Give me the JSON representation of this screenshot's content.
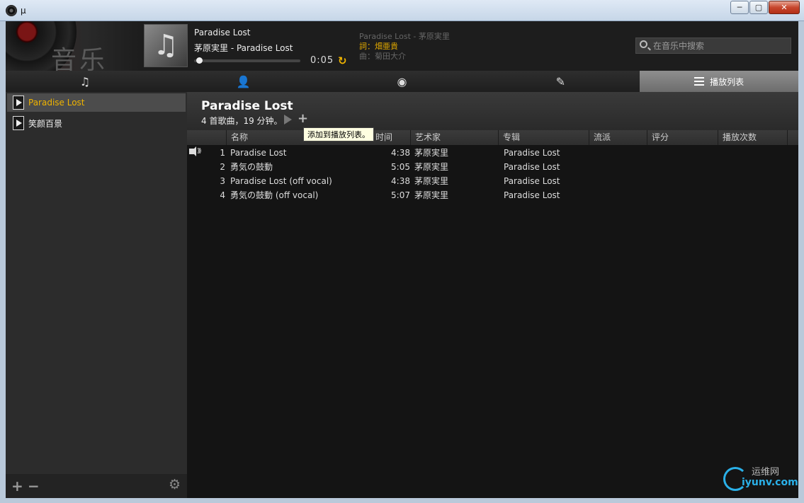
{
  "window": {
    "title": "μ",
    "minimize": "─",
    "maximize": "▢",
    "close": "✕"
  },
  "header": {
    "logo_text": "音乐",
    "now_playing": {
      "title": "Paradise Lost",
      "artist_album": "茅原実里 - Paradise Lost",
      "time": "0:05",
      "progress": 0.02
    },
    "lyrics": {
      "line1": "Paradise Lost - 茅原実里",
      "line2": "詞：畑亜貴",
      "line3": "曲：菊田大介"
    },
    "search": {
      "placeholder": "在音乐中搜索"
    }
  },
  "tabs": [
    {
      "label": "",
      "icon": "music-note-icon"
    },
    {
      "label": "",
      "icon": "artist-icon"
    },
    {
      "label": "",
      "icon": "album-disc-icon"
    },
    {
      "label": "",
      "icon": "guitar-genre-icon"
    },
    {
      "label": "播放列表",
      "icon": "list-icon"
    }
  ],
  "sidebar": {
    "items": [
      {
        "label": "Paradise Lost",
        "active": true
      },
      {
        "label": "笑颜百景",
        "active": false
      }
    ]
  },
  "playlist": {
    "title": "Paradise Lost",
    "summary": "4 首歌曲，19 分钟。",
    "tooltip": "添加到播放列表。",
    "columns": {
      "name": "名称",
      "time": "时间",
      "artist": "艺术家",
      "album": "专辑",
      "genre": "流派",
      "rating": "评分",
      "plays": "播放次数"
    },
    "tracks": [
      {
        "num": "1",
        "name": "Paradise Lost",
        "time": "4:38",
        "artist": "茅原実里",
        "album": "Paradise Lost",
        "playing": true
      },
      {
        "num": "2",
        "name": "勇気の鼓動",
        "time": "5:05",
        "artist": "茅原実里",
        "album": "Paradise Lost",
        "playing": false
      },
      {
        "num": "3",
        "name": "Paradise Lost (off vocal)",
        "time": "4:38",
        "artist": "茅原実里",
        "album": "Paradise Lost",
        "playing": false
      },
      {
        "num": "4",
        "name": "勇気の鼓動 (off vocal)",
        "time": "5:07",
        "artist": "茅原実里",
        "album": "Paradise Lost",
        "playing": false
      }
    ]
  },
  "watermark": {
    "cn": "运维网",
    "en": "iyunv.com"
  },
  "colors": {
    "accent": "#f0b400",
    "background": "#141414",
    "sidebar": "#2c2c2c"
  }
}
